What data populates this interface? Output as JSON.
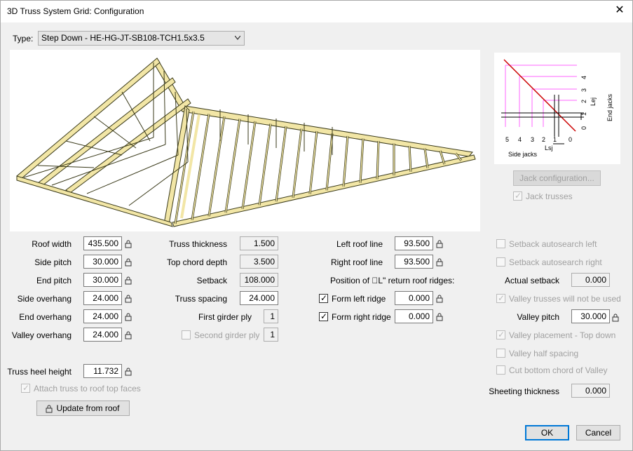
{
  "window": {
    "title": "3D Truss System Grid: Configuration",
    "close_icon": "close-icon"
  },
  "type": {
    "label": "Type:",
    "value": "Step Down - HE-HG-JT-SB108-TCH1.5x3.5"
  },
  "left": {
    "roof_width": {
      "label": "Roof width",
      "value": "435.500"
    },
    "side_pitch": {
      "label": "Side pitch",
      "value": "30.000"
    },
    "end_pitch": {
      "label": "End pitch",
      "value": "30.000"
    },
    "side_overhang": {
      "label": "Side overhang",
      "value": "24.000"
    },
    "end_overhang": {
      "label": "End overhang",
      "value": "24.000"
    },
    "valley_overhang": {
      "label": "Valley overhang",
      "value": "24.000"
    },
    "truss_heel_height": {
      "label": "Truss heel height",
      "value": "11.732"
    },
    "attach_truss": {
      "label": "Attach truss to roof top faces",
      "checked": true
    },
    "update_button": "Update from roof"
  },
  "middle": {
    "truss_thickness": {
      "label": "Truss thickness",
      "value": "1.500"
    },
    "top_chord_depth": {
      "label": "Top chord depth",
      "value": "3.500"
    },
    "setback": {
      "label": "Setback",
      "value": "108.000"
    },
    "truss_spacing": {
      "label": "Truss spacing",
      "value": "24.000"
    },
    "first_girder_ply": {
      "label": "First girder ply",
      "value": "1"
    },
    "second_girder_ply": {
      "label": "Second girder ply",
      "value": "1",
      "checked": false
    }
  },
  "right_mid": {
    "left_roof_line": {
      "label": "Left roof line",
      "value": "93.500"
    },
    "right_roof_line": {
      "label": "Right roof line",
      "value": "93.500"
    },
    "position_heading": "Position of \u0000L\" return roof ridges:",
    "form_left_ridge": {
      "label": "Form left ridge",
      "value": "0.000",
      "checked": true
    },
    "form_right_ridge": {
      "label": "Form right ridge",
      "value": "0.000",
      "checked": true
    }
  },
  "jack": {
    "button": "Jack configuration...",
    "jack_trusses": {
      "label": "Jack trusses",
      "checked": true
    },
    "side_jacks": "Side jacks",
    "end_jacks": "End jacks",
    "lsj": "Lsj",
    "lej": "Lej",
    "x_ticks": [
      "5",
      "4",
      "3",
      "2",
      "1",
      "0"
    ],
    "y_ticks": [
      "4",
      "3",
      "2",
      "1",
      "0"
    ]
  },
  "far_right": {
    "setback_left": {
      "label": "Setback autosearch left",
      "checked": false
    },
    "setback_right": {
      "label": "Setback autosearch right",
      "checked": false
    },
    "actual_setback": {
      "label": "Actual setback",
      "value": "0.000"
    },
    "valley_not_used": {
      "label": "Valley trusses will not be used",
      "checked": true
    },
    "valley_pitch": {
      "label": "Valley pitch",
      "value": "30.000"
    },
    "valley_top_down": {
      "label": "Valley placement - Top down",
      "checked": true
    },
    "valley_half": {
      "label": "Valley half spacing",
      "checked": false
    },
    "cut_bottom": {
      "label": "Cut bottom chord of Valley",
      "checked": false
    },
    "sheeting_thickness": {
      "label": "Sheeting thickness",
      "value": "0.000"
    }
  },
  "footer": {
    "ok": "OK",
    "cancel": "Cancel"
  },
  "colors": {
    "truss_fill": "#f2e6a6",
    "truss_stroke": "#3a3a1a",
    "diagram_magenta": "#ff66ff",
    "diagram_red": "#cc0000",
    "accent": "#0078d7"
  }
}
